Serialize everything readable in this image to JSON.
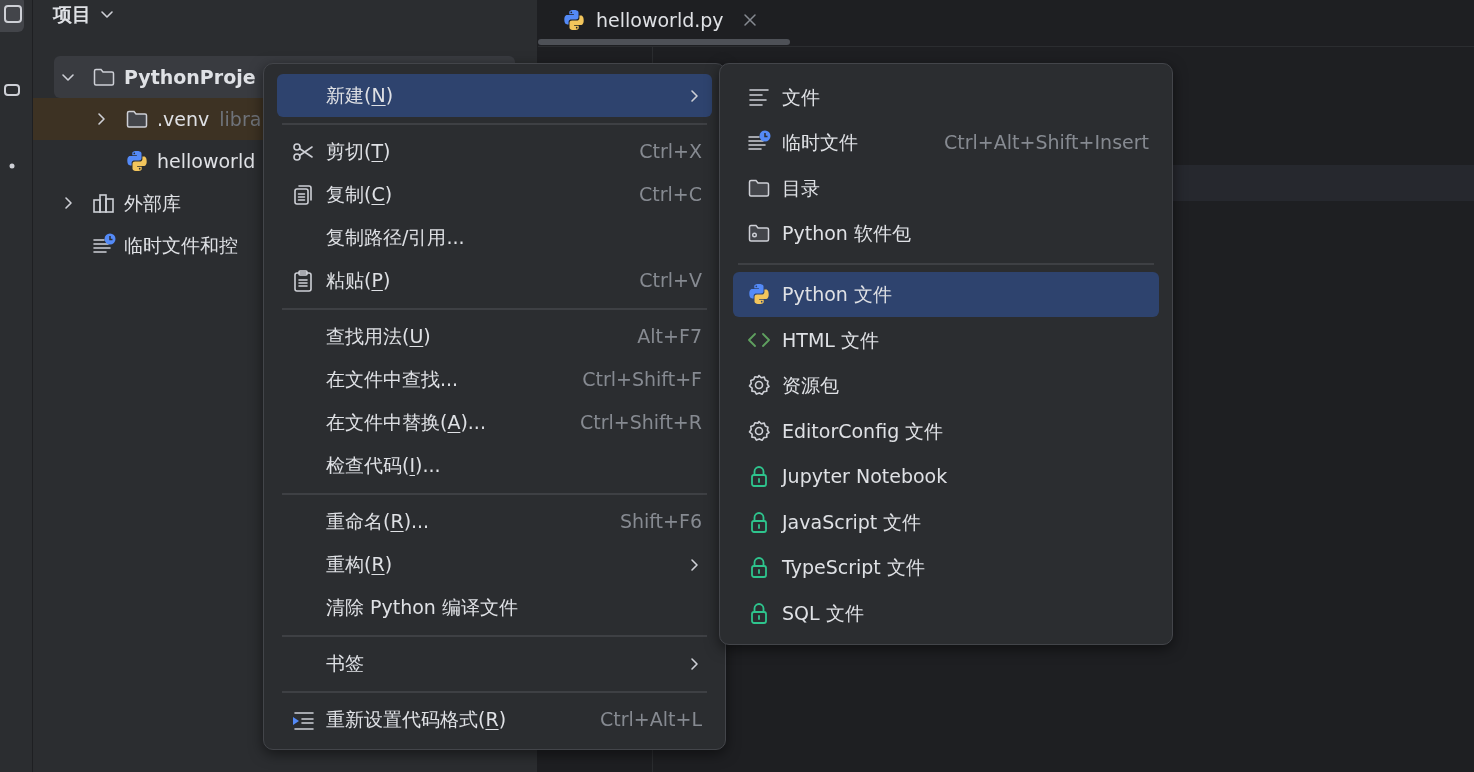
{
  "activity_bar": [
    {
      "kind": "project",
      "selected": true
    },
    {
      "kind": "structure",
      "selected": false
    },
    {
      "kind": "more",
      "selected": false
    }
  ],
  "project_panel": {
    "title": "项目",
    "tree": [
      {
        "kind": "project",
        "label": "PythonProje",
        "expanded": true,
        "selected": true,
        "highlighted": false,
        "children": [
          {
            "kind": "folder",
            "label": ".venv",
            "note": "libra",
            "expanded": false,
            "selected": false,
            "highlighted": true
          },
          {
            "kind": "python",
            "label": "helloworld",
            "selected": false,
            "highlighted": false
          }
        ]
      },
      {
        "kind": "library",
        "label": "外部库",
        "expanded": false,
        "selected": false,
        "highlighted": false
      },
      {
        "kind": "scratch",
        "label": "临时文件和控",
        "selected": false,
        "highlighted": false
      }
    ]
  },
  "editor": {
    "tabs": [
      {
        "label": "helloworld.py",
        "selected": true
      }
    ]
  },
  "context_menu": [
    {
      "kind": "plain",
      "label": "新建(N)",
      "submenu": true,
      "selected": true
    },
    {
      "kind": "separator"
    },
    {
      "kind": "scissors",
      "label": "剪切(T)",
      "shortcut": "Ctrl+X",
      "selected": false
    },
    {
      "kind": "copy",
      "label": "复制(C)",
      "shortcut": "Ctrl+C",
      "selected": false
    },
    {
      "kind": "plain",
      "label": "复制路径/引用...",
      "selected": false
    },
    {
      "kind": "paste",
      "label": "粘贴(P)",
      "shortcut": "Ctrl+V",
      "selected": false
    },
    {
      "kind": "separator"
    },
    {
      "kind": "plain",
      "label": "查找用法(U)",
      "shortcut": "Alt+F7",
      "selected": false
    },
    {
      "kind": "plain",
      "label": "在文件中查找...",
      "shortcut": "Ctrl+Shift+F",
      "selected": false
    },
    {
      "kind": "plain",
      "label": "在文件中替换(A)...",
      "shortcut": "Ctrl+Shift+R",
      "selected": false
    },
    {
      "kind": "plain",
      "label": "检查代码(I)...",
      "selected": false
    },
    {
      "kind": "separator"
    },
    {
      "kind": "plain",
      "label": "重命名(R)...",
      "shortcut": "Shift+F6",
      "selected": false
    },
    {
      "kind": "plain",
      "label": "重构(R)",
      "submenu": true,
      "selected": false
    },
    {
      "kind": "plain",
      "label": "清除 Python 编译文件",
      "selected": false
    },
    {
      "kind": "separator"
    },
    {
      "kind": "plain",
      "label": "书签",
      "submenu": true,
      "selected": false
    },
    {
      "kind": "separator"
    },
    {
      "kind": "format",
      "label": "重新设置代码格式(R)",
      "shortcut": "Ctrl+Alt+L",
      "selected": false
    }
  ],
  "new_submenu": [
    {
      "kind": "file",
      "label": "文件",
      "selected": false
    },
    {
      "kind": "scratch",
      "label": "临时文件",
      "shortcut": "Ctrl+Alt+Shift+Insert",
      "selected": false
    },
    {
      "kind": "folder",
      "label": "目录",
      "selected": false
    },
    {
      "kind": "package",
      "label": "Python 软件包",
      "selected": false
    },
    {
      "kind": "separator"
    },
    {
      "kind": "python",
      "label": "Python 文件",
      "selected": true
    },
    {
      "kind": "html",
      "label": "HTML 文件",
      "selected": false
    },
    {
      "kind": "gear",
      "label": "资源包",
      "selected": false
    },
    {
      "kind": "gear",
      "label": "EditorConfig 文件",
      "selected": false
    },
    {
      "kind": "lock",
      "label": "Jupyter Notebook",
      "selected": false
    },
    {
      "kind": "lock",
      "label": "JavaScript 文件",
      "selected": false
    },
    {
      "kind": "lock",
      "label": "TypeScript 文件",
      "selected": false
    },
    {
      "kind": "lock",
      "label": "SQL 文件",
      "selected": false
    }
  ]
}
